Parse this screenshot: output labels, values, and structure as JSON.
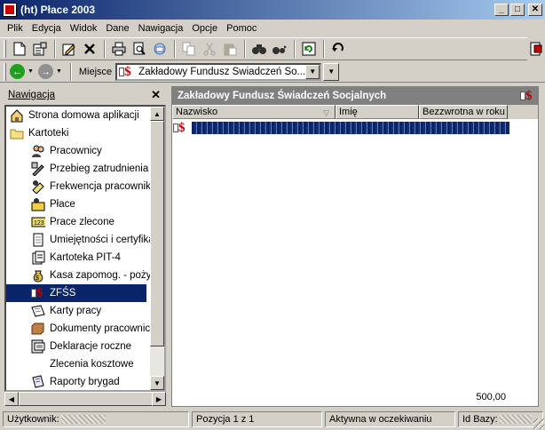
{
  "window": {
    "title": "(ht)  Płace 2003",
    "minimize": "_",
    "maximize": "□",
    "close": "✕"
  },
  "menu": [
    "Plik",
    "Edycja",
    "Widok",
    "Dane",
    "Nawigacja",
    "Opcje",
    "Pomoc"
  ],
  "toolbar": {
    "icons": [
      "new-icon",
      "properties-icon",
      "edit-icon",
      "delete-icon",
      "print-icon",
      "print-preview-icon",
      "mail-icon",
      "copy-icon",
      "cut-icon",
      "paste-icon",
      "find-icon",
      "find-next-icon",
      "refresh-icon",
      "undo-icon"
    ]
  },
  "address": {
    "back": "←",
    "forward": "→",
    "label": "Miejsce",
    "value": "Zakładowy Fundusz Świadczeń So..."
  },
  "nav_panel": {
    "title": "Nawigacja",
    "close": "✕",
    "items": [
      {
        "label": "Strona domowa aplikacji",
        "icon": "home-icon",
        "level": 0
      },
      {
        "label": "Kartoteki",
        "icon": "folder-icon",
        "level": 0
      },
      {
        "label": "Pracownicy",
        "icon": "employees-icon",
        "level": 1
      },
      {
        "label": "Przebieg zatrudnienia",
        "icon": "employment-history-icon",
        "level": 1
      },
      {
        "label": "Frekwencja pracowników",
        "icon": "attendance-icon",
        "level": 1
      },
      {
        "label": "Płace",
        "icon": "payroll-icon",
        "level": 1
      },
      {
        "label": "Prace zlecone",
        "icon": "contract-work-icon",
        "level": 1
      },
      {
        "label": "Umiejętności i certyfikaty",
        "icon": "skills-icon",
        "level": 1
      },
      {
        "label": "Kartoteka PIT-4",
        "icon": "pit4-icon",
        "level": 1
      },
      {
        "label": "Kasa zapomog. - pożyczkowa",
        "icon": "money-bag-icon",
        "level": 1
      },
      {
        "label": "ZFŚS",
        "icon": "zfss-icon",
        "level": 1,
        "selected": true
      },
      {
        "label": "Karty pracy",
        "icon": "work-cards-icon",
        "level": 1
      },
      {
        "label": "Dokumenty pracownicze",
        "icon": "documents-icon",
        "level": 1
      },
      {
        "label": "Deklaracje roczne",
        "icon": "declarations-icon",
        "level": 1
      },
      {
        "label": "Zlecenia kosztowe",
        "icon": "",
        "level": 1
      },
      {
        "label": "Raporty brygad",
        "icon": "reports-icon",
        "level": 1
      }
    ]
  },
  "main": {
    "title": "Zakładowy Fundusz Świadczeń Socjalnych",
    "columns": [
      "Nazwisko",
      "Imię",
      "Bezzwrotna w roku"
    ],
    "sort_indicator": "▽",
    "total": "500,00"
  },
  "status": {
    "user_label": "Użytkownik:",
    "position": "Pozycja 1 z 1",
    "state": "Aktywna w oczekiwaniu",
    "db_label": "Id Bazy:"
  }
}
